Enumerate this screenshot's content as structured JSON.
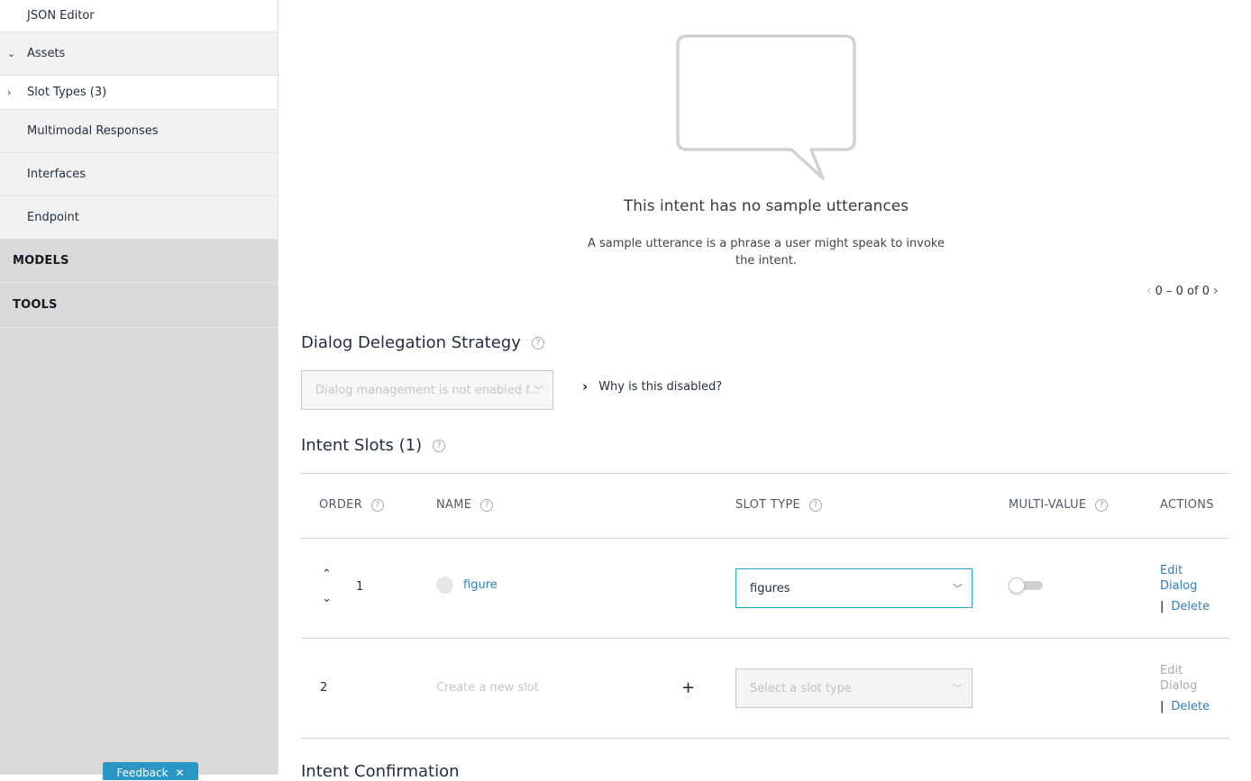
{
  "sidebar": {
    "items": [
      {
        "label": "JSON Editor",
        "chevron": ""
      },
      {
        "label": "Assets",
        "chevron": "⌄"
      },
      {
        "label": "Slot Types (3)",
        "chevron": "›"
      },
      {
        "label": "Multimodal Responses",
        "chevron": ""
      },
      {
        "label": "Interfaces",
        "chevron": ""
      },
      {
        "label": "Endpoint",
        "chevron": ""
      }
    ],
    "sections": [
      "MODELS",
      "TOOLS"
    ],
    "feedback_label": "Feedback",
    "feedback_close": "✕"
  },
  "utterances": {
    "empty_title": "This intent has no sample utterances",
    "empty_desc": "A sample utterance is a phrase a user might speak to invoke the intent.",
    "pager": "0 – 0 of 0",
    "prev": "‹",
    "next": "›"
  },
  "delegation": {
    "title": "Dialog Delegation Strategy",
    "help": "?",
    "dropdown_value": "Dialog management is not enabled f...",
    "why_label": "Why is this disabled?",
    "why_chevron": "›"
  },
  "slots": {
    "title": "Intent Slots (1)",
    "help": "?",
    "columns": [
      "ORDER",
      "NAME",
      "SLOT TYPE",
      "MULTI-VALUE",
      "ACTIONS"
    ],
    "rows": [
      {
        "order": "1",
        "name": "figure",
        "slot_type": "figures",
        "multi_value": false,
        "edit": "Edit Dialog",
        "delete": "Delete"
      },
      {
        "order": "2",
        "name_placeholder": "Create a new slot",
        "add": "+",
        "slot_type_placeholder": "Select a slot type",
        "edit": "Edit Dialog",
        "delete": "Delete"
      }
    ],
    "up_arrow": "⌃",
    "down_arrow": "⌄",
    "separator": "|"
  },
  "confirmation": {
    "title": "Intent Confirmation"
  },
  "colors": {
    "link": "#2f7fb8",
    "active_border": "#2d9fd0",
    "feedback": "#2b95c4"
  }
}
